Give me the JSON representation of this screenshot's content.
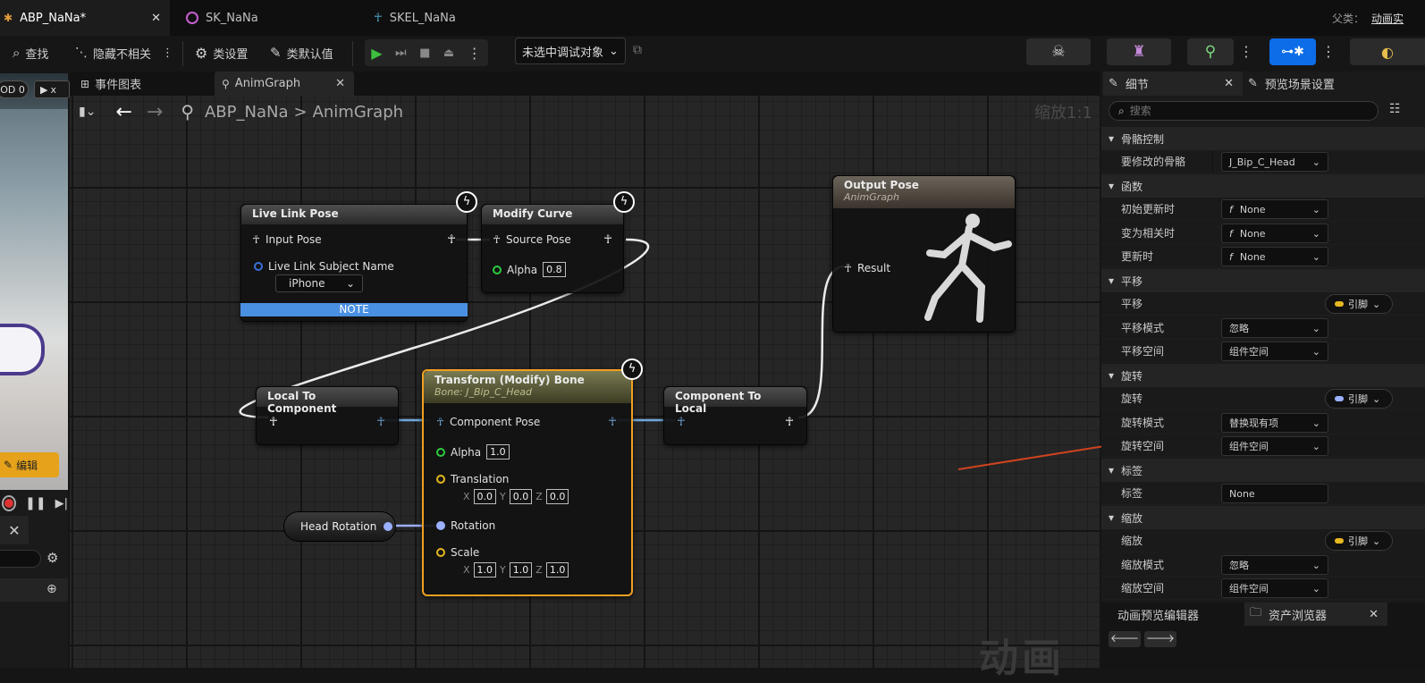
{
  "editor_tabs": [
    {
      "label": "ABP_NaNa*"
    },
    {
      "label": "SK_NaNa"
    },
    {
      "label": "SKEL_NaNa"
    }
  ],
  "parent_label": "父类：",
  "parent_value": "动画实",
  "toolbar": {
    "find": "查找",
    "hide_unrelated": "隐藏不相关",
    "class_settings": "类设置",
    "class_defaults": "类默认值",
    "debug_target": "未选中调试对象"
  },
  "left_panel": {
    "lod_label": "OD 0",
    "play_x": "x",
    "edit_button": "编辑"
  },
  "graph_tabs": [
    {
      "label": "事件图表"
    },
    {
      "label": "AnimGraph"
    }
  ],
  "breadcrumb": {
    "root": "ABP_NaNa",
    "sep": ">",
    "current": "AnimGraph"
  },
  "zoom_label": "缩放1:1",
  "watermark": "动画",
  "nodes": {
    "live_link": {
      "title": "Live Link Pose",
      "input_pose": "Input Pose",
      "subject_label": "Live Link Subject Name",
      "subject_value": "iPhone",
      "note": "NOTE"
    },
    "modify_curve": {
      "title": "Modify Curve",
      "source_pose": "Source Pose",
      "alpha_label": "Alpha",
      "alpha": "0.8"
    },
    "output_pose": {
      "title": "Output Pose",
      "subtitle": "AnimGraph",
      "result": "Result"
    },
    "local_to_component": {
      "title": "Local To Component"
    },
    "transform_bone": {
      "title": "Transform (Modify) Bone",
      "subtitle": "Bone: J_Bip_C_Head",
      "component_pose": "Component Pose",
      "alpha_label": "Alpha",
      "alpha": "1.0",
      "translation_label": "Translation",
      "translation": {
        "x": "0.0",
        "y": "0.0",
        "z": "0.0"
      },
      "rotation_label": "Rotation",
      "scale_label": "Scale",
      "scale": {
        "x": "1.0",
        "y": "1.0",
        "z": "1.0"
      },
      "axis_x": "X",
      "axis_y": "Y",
      "axis_z": "Z"
    },
    "component_to_local": {
      "title": "Component To Local"
    },
    "head_rotation": {
      "label": "Head Rotation"
    }
  },
  "details": {
    "tab_details": "细节",
    "tab_preview": "预览场景设置",
    "search_placeholder": "搜索",
    "sections": {
      "skeletal": "骨骼控制",
      "functions": "函数",
      "translation": "平移",
      "rotation": "旋转",
      "tag": "标签",
      "scale": "缩放"
    },
    "rows": {
      "bone_to_modify": {
        "label": "要修改的骨骼",
        "value": "J_Bip_C_Head"
      },
      "on_initial_update": {
        "label": "初始更新时",
        "value": "None",
        "prefix": "f"
      },
      "on_become_relevant": {
        "label": "变为相关时",
        "value": "None",
        "prefix": "f"
      },
      "on_update": {
        "label": "更新时",
        "value": "None",
        "prefix": "f"
      },
      "translation": {
        "label": "平移",
        "value": "引脚"
      },
      "translation_mode": {
        "label": "平移模式",
        "value": "忽略"
      },
      "translation_space": {
        "label": "平移空间",
        "value": "组件空间"
      },
      "rotation": {
        "label": "旋转",
        "value": "引脚"
      },
      "rotation_mode": {
        "label": "旋转模式",
        "value": "替换现有项"
      },
      "rotation_space": {
        "label": "旋转空间",
        "value": "组件空间"
      },
      "tag": {
        "label": "标签",
        "value": "None"
      },
      "scale": {
        "label": "缩放",
        "value": "引脚"
      },
      "scale_mode": {
        "label": "缩放模式",
        "value": "忽略"
      },
      "scale_space": {
        "label": "缩放空间",
        "value": "组件空间"
      }
    },
    "bottom_tabs": {
      "preview_editor": "动画预览编辑器",
      "asset_browser": "资产浏览器"
    }
  },
  "colors": {
    "accent_blue": "#3b82f6",
    "selected_orange": "#f0a020",
    "pin_green": "#2ecc40",
    "pin_yellow": "#e6b820",
    "pin_rotation": "#9bb0ff",
    "arrow_red": "#d0431f"
  }
}
